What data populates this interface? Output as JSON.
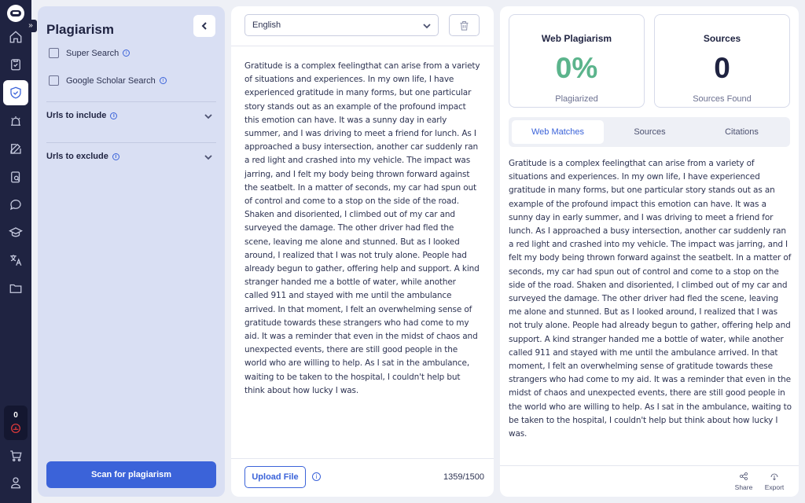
{
  "rail": {
    "expand_glyph": "»",
    "credits": "0",
    "items": [
      {
        "icon": "home-icon"
      },
      {
        "icon": "clipboard-check-icon"
      },
      {
        "icon": "shield-check-icon",
        "active": true
      },
      {
        "icon": "alarm-icon"
      },
      {
        "icon": "edit-icon"
      },
      {
        "icon": "document-search-icon"
      },
      {
        "icon": "chat-icon"
      },
      {
        "icon": "graduation-cap-icon"
      },
      {
        "icon": "translate-icon"
      },
      {
        "icon": "folder-icon"
      },
      {
        "icon": "cart-icon"
      },
      {
        "icon": "user-icon"
      }
    ]
  },
  "options": {
    "title": "Plagiarism",
    "super_search": "Super Search",
    "google_scholar": "Google Scholar Search",
    "urls_include": "Urls to include",
    "urls_exclude": "Urls to exclude",
    "scan_button": "Scan for plagiarism",
    "info_glyph": "i"
  },
  "editor": {
    "language": "English",
    "text": "Gratitude is a complex feelingthat can arise from a variety of situations and experiences. In my own life, I have experienced gratitude in many forms, but one particular story stands out as an example of the profound impact this emotion can have. It was a sunny day in early summer, and I was driving to meet a friend for lunch. As I approached a busy intersection, another car suddenly ran a red light and crashed into my vehicle. The impact was jarring, and I felt my body being thrown forward against the seatbelt. In a matter of seconds, my car had spun out of control and come to a stop on the side of the road. Shaken and disoriented, I climbed out of my car and surveyed the damage. The other driver had fled the scene, leaving me alone and stunned. But as I looked around, I realized that I was not truly alone. People had already begun to gather, offering help and support. A kind stranger handed me a bottle of water, while another called 911 and stayed with me until the ambulance arrived. In that moment, I felt an overwhelming sense of gratitude towards these strangers who had come to my aid. It was a reminder that even in the midst of chaos and unexpected events, there are still good people in the world who are willing to help. As I sat in the ambulance, waiting to be taken to the hospital, I couldn't help but think about how lucky I was.",
    "upload_button": "Upload File",
    "info_glyph": "i",
    "counter": "1359/1500"
  },
  "results": {
    "web_plagiarism": {
      "title": "Web Plagiarism",
      "value": "0%",
      "label": "Plagiarized",
      "color": "#5bb48c"
    },
    "sources": {
      "title": "Sources",
      "value": "0",
      "label": "Sources Found",
      "color": "#1f2341"
    },
    "tabs": [
      "Web Matches",
      "Sources",
      "Citations"
    ],
    "active_tab": 0,
    "text": "Gratitude is a complex feelingthat can arise from a variety of situations and experiences. In my own life, I have experienced gratitude in many forms, but one particular story stands out as an example of the profound impact this emotion can have. It was a sunny day in early summer, and I was driving to meet a friend for lunch. As I approached a busy intersection, another car suddenly ran a red light and crashed into my vehicle. The impact was jarring, and I felt my body being thrown forward against the seatbelt. In a matter of seconds, my car had spun out of control and come to a stop on the side of the road. Shaken and disoriented, I climbed out of my car and surveyed the damage. The other driver had fled the scene, leaving me alone and stunned. But as I looked around, I realized that I was not truly alone. People had already begun to gather, offering help and support. A kind stranger handed me a bottle of water, while another called 911 and stayed with me until the ambulance arrived. In that moment, I felt an overwhelming sense of gratitude towards these strangers who had come to my aid. It was a reminder that even in the midst of chaos and unexpected events, there are still good people in the world who are willing to help. As I sat in the ambulance, waiting to be taken to the hospital, I couldn't help but think about how lucky I was.",
    "share": "Share",
    "export": "Export"
  }
}
